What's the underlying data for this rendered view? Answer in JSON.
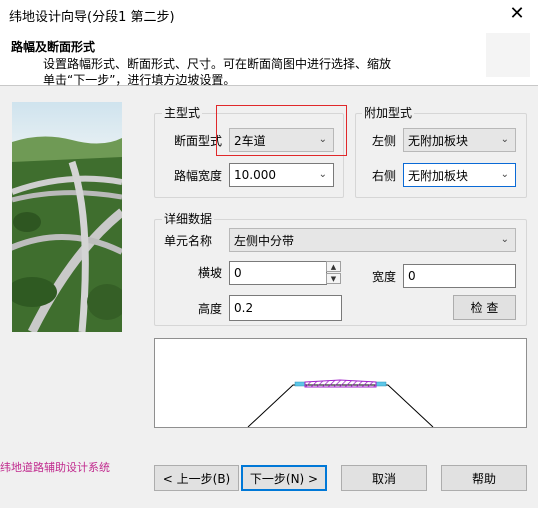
{
  "window": {
    "title": "纬地设计向导(分段1 第二步)",
    "close_glyph": "✕"
  },
  "header": {
    "title": "路幅及断面形式",
    "desc_line1": "设置路幅形式、断面形式、尺寸。可在断面简图中进行选择、缩放",
    "desc_line2": "单击“下一步”，进行填方边坡设置。"
  },
  "main_type": {
    "group_title": "主型式",
    "section_type_label": "断面型式",
    "section_type_value": "2车道",
    "width_label": "路幅宽度",
    "width_value": "10.000"
  },
  "attach_type": {
    "group_title": "附加型式",
    "left_label": "左侧",
    "left_value": "无附加板块",
    "right_label": "右侧",
    "right_value": "无附加板块"
  },
  "details": {
    "group_title": "详细数据",
    "unit_name_label": "单元名称",
    "unit_name_value": "左侧中分带",
    "slope_label": "横坡",
    "slope_value": "0",
    "width_label": "宽度",
    "width_value": "0",
    "height_label": "高度",
    "height_value": "0.2",
    "check_button": "检 查"
  },
  "buttons": {
    "prev": "< 上一步(B)",
    "next": "下一步(N) >",
    "cancel": "取消",
    "help": "帮助"
  },
  "status_text": "纬地道路辅助设计系统",
  "colors": {
    "highlight": "#e0282a",
    "status": "#c12a8e",
    "accent": "#0078d7"
  },
  "icons": {
    "close": "close-icon",
    "dropdown": "chevron-down-icon",
    "spin_up": "spin-up-icon",
    "spin_down": "spin-down-icon"
  }
}
